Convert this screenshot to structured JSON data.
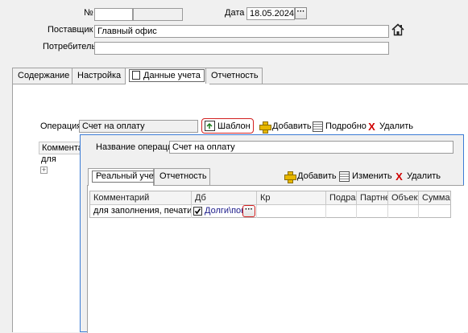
{
  "header": {
    "number_label": "№",
    "number_value": "",
    "date_label": "Дата",
    "date_value": "18.05.2024",
    "supplier_label": "Поставщик",
    "supplier_value": "Главный офис",
    "consumer_label": "Потребитель",
    "consumer_value": ""
  },
  "main_tabs": [
    {
      "label": "Содержание"
    },
    {
      "label": "Настройка"
    },
    {
      "label": "Данные учета"
    },
    {
      "label": "Отчетность"
    }
  ],
  "operation_row": {
    "label": "Операция",
    "value": "Счет на оплату",
    "template_button": "Шаблон",
    "add_button": "Добавить",
    "details_button": "Подробно",
    "delete_button": "Удалить"
  },
  "background_table": {
    "header_partial": "Коммента",
    "row_partial": "для заполн",
    "expand_symbol": "+"
  },
  "popup": {
    "op_name_label": "Название операции",
    "op_name_value": "Счет на оплату",
    "tabs": [
      {
        "label": "Реальный учет"
      },
      {
        "label": "Отчетность"
      }
    ],
    "toolbar": {
      "add": "Добавить",
      "edit": "Изменить",
      "delete": "Удалить"
    },
    "table": {
      "columns": [
        "Комментарий",
        "Дб",
        "Кр",
        "Подраз",
        "Партне",
        "Объект",
        "Сумма"
      ],
      "rows": [
        {
          "comment": "для заполнения, печати",
          "db": "Долги\\поку",
          "db_checked": true,
          "kr": "",
          "podraz": "",
          "partner": "",
          "object": "",
          "sum": ""
        }
      ]
    }
  },
  "icons": {
    "home": "house-icon",
    "template": "template-doc-icon",
    "add": "plus-icon",
    "details": "grid-icon",
    "delete": "red-x-icon",
    "ellipsis": "ellipsis-icon"
  },
  "colors": {
    "window_bg": "#f0f0f0",
    "popup_border": "#3a7bd5",
    "highlight": "#d21f1f",
    "delete_red": "#d00000"
  }
}
